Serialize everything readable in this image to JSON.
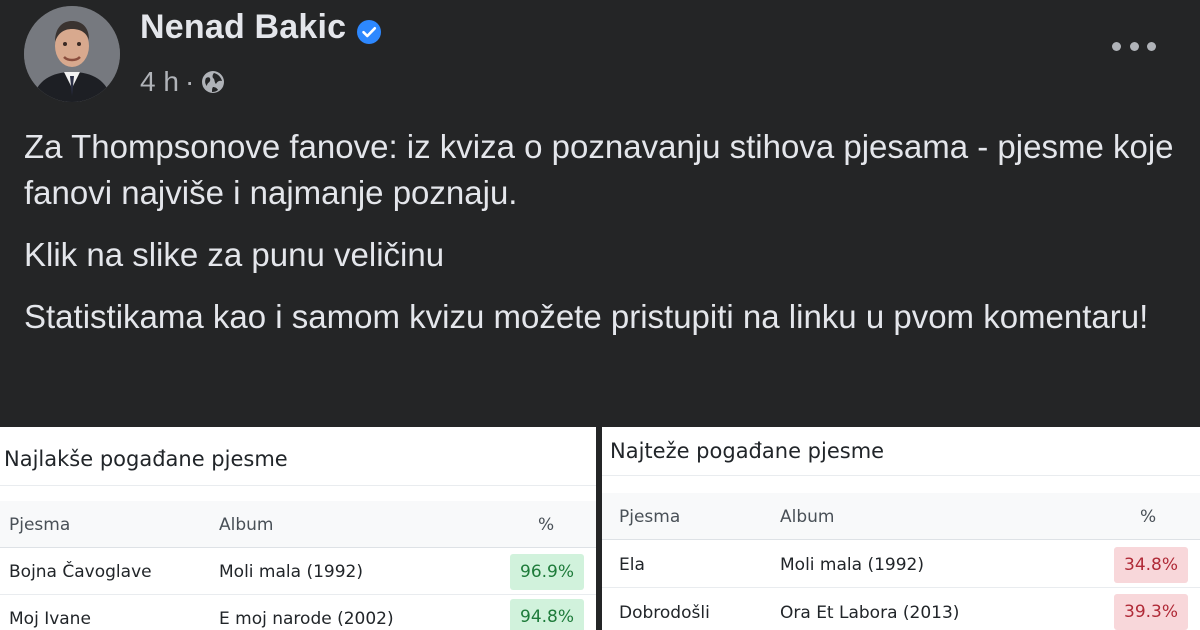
{
  "post": {
    "author": "Nenad Bakic",
    "time": "4 h",
    "separator": "·",
    "paragraphs": [
      "Za Thompsonove fanove: iz kviza o poznavanju stihova pjesama - pjesme koje fanovi najviše i najmanje poznaju.",
      "Klik na slike za punu veličinu",
      "Statistikama kao i samom kvizu možete pristupiti na linku u pvom komentaru!"
    ],
    "icons": {
      "verified": "verified-badge-icon",
      "audience": "globe-icon",
      "menu": "more-options-icon"
    }
  },
  "tables": {
    "easiest": {
      "title": "Najlakše pogađane pjesme",
      "headers": [
        "Pjesma",
        "Album",
        "%"
      ],
      "rows": [
        {
          "song": "Bojna Čavoglave",
          "album": "Moli mala (1992)",
          "pct": "96.9%"
        },
        {
          "song": "Moj Ivane",
          "album": "E moj narode (2002)",
          "pct": "94.8%"
        }
      ]
    },
    "hardest": {
      "title": "Najteže pogađane pjesme",
      "headers": [
        "Pjesma",
        "Album",
        "%"
      ],
      "rows": [
        {
          "song": "Ela",
          "album": "Moli mala (1992)",
          "pct": "34.8%"
        },
        {
          "song": "Dobrodošli",
          "album": "Ora Et Labora (2013)",
          "pct": "39.3%"
        }
      ]
    }
  },
  "colors": {
    "background": "#242526",
    "text_primary": "#e4e6eb",
    "text_secondary": "#b0b3b8",
    "verified": "#2d88ff",
    "pct_high": "#d1f2dc",
    "pct_low": "#f8d7da"
  }
}
